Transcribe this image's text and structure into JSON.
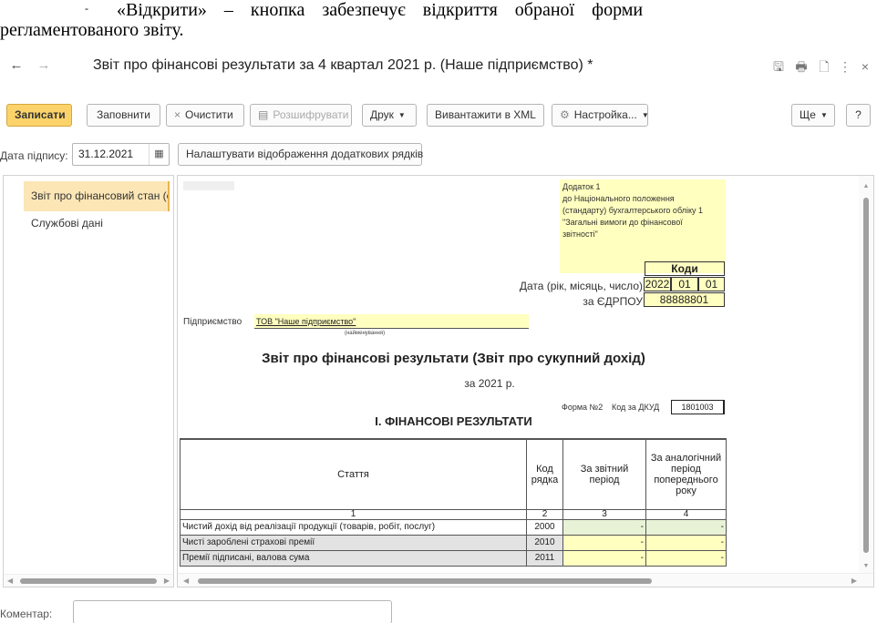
{
  "document": {
    "line1_dash": "-",
    "line1_text": "«Відкрити» – кнопка забезпечує відкриття обраної форми",
    "line2_text": "регламентованого звіту."
  },
  "window": {
    "title": "Звіт про фінансові результати за 4 квартал 2021 р. (Наше підприємство) *",
    "back": "←",
    "forward": "→",
    "controls": [
      "🖫",
      "🖶",
      "🗋",
      "⋮",
      "×"
    ]
  },
  "toolbar": {
    "save": "Записати",
    "fill": "Заповнити",
    "clear_icon": "×",
    "clear": "Очистити",
    "decode_icon": "▤",
    "decode": "Розшифрувати",
    "print": "Друк",
    "export_xml": "Вивантажити в XML",
    "settings_icon": "⚙",
    "settings": "Настройка...",
    "more": "Ще",
    "help": "?"
  },
  "sign_date": {
    "label": "Дата підпису:",
    "value": "31.12.2021",
    "calendar_icon": "▦",
    "configure_rows_button": "Налаштувати відображення додаткових рядків"
  },
  "sidebar": {
    "items": [
      {
        "label": "Звіт про фінансовий стан (ста",
        "selected": true
      },
      {
        "label": "Службові дані",
        "selected": false
      }
    ]
  },
  "report": {
    "annex": [
      "Додаток 1",
      "до Національного положення",
      "(стандарту) бухгалтерського обліку 1",
      "\"Загальні вимоги до фінансової",
      "звітності\""
    ],
    "codes_title": "Коди",
    "date_label": "Дата (рік, місяць, число)",
    "date_year": "2022",
    "date_month": "01",
    "date_day": "01",
    "edrpou_label": "за ЄДРПОУ",
    "edrpou_value": "88888801",
    "enterprise_label": "Підприємство",
    "enterprise_value": "ТОВ \"Наше підприємство\"",
    "enterprise_note": "(найменування)",
    "title": "Звіт про фінансові результати (Звіт про сукупний дохід)",
    "year": "за 2021 р.",
    "form_label": "Форма №2",
    "dkud_label": "Код за ДКУД",
    "dkud_value": "1801003",
    "section": "І. ФІНАНСОВІ РЕЗУЛЬТАТИ",
    "table": {
      "headers": [
        "Стаття",
        "Код рядка",
        "За звітний період",
        "За аналогічний період попереднього року"
      ],
      "numbers": [
        "1",
        "2",
        "3",
        "4"
      ],
      "rows": [
        {
          "name": "Чистий дохід від реалізації продукції (товарів, робіт, послуг)",
          "code": "2000",
          "current": "-",
          "previous": "-"
        },
        {
          "name": "Чисті зароблені страхові премії",
          "code": "2010",
          "current": "-",
          "previous": "-"
        },
        {
          "name": "Премії підписані, валова сума",
          "code": "2011",
          "current": "-",
          "previous": "-"
        }
      ]
    }
  },
  "comment": {
    "label": "Коментар:",
    "value": ""
  }
}
